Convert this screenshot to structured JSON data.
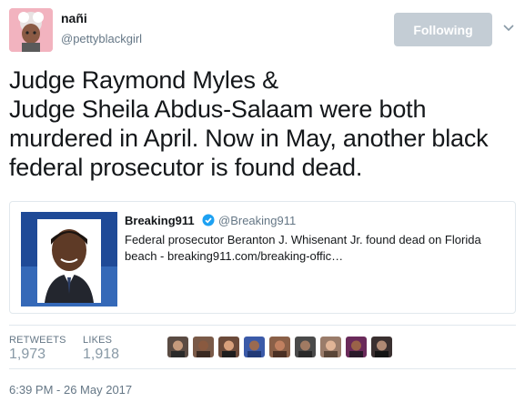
{
  "author": {
    "display_name": "nañi",
    "handle": "@pettyblackgirl"
  },
  "follow_button": {
    "label": "Following"
  },
  "tweet": {
    "lines": [
      "Judge Raymond Myles &",
      "Judge Sheila Abdus-Salaam were both",
      "murdered in April. Now in May, another black",
      "federal prosecutor is found dead."
    ]
  },
  "quoted": {
    "name": "Breaking911",
    "handle": "@Breaking911",
    "text": "Federal prosecutor Beranton J. Whisenant Jr. found dead on Florida beach - breaking911.com/breaking-offic…"
  },
  "stats": {
    "retweets_label": "RETWEETS",
    "retweets_count": "1,973",
    "likes_label": "LIKES",
    "likes_count": "1,918"
  },
  "liker_avatars": [
    {
      "color": "#5a4b43"
    },
    {
      "color": "#7a5a48"
    },
    {
      "color": "#6b4a3a"
    },
    {
      "color": "#3b5aa8"
    },
    {
      "color": "#8a6048"
    },
    {
      "color": "#4a4a4a"
    },
    {
      "color": "#9a7c6a"
    },
    {
      "color": "#6a2a5a"
    },
    {
      "color": "#3a3030"
    }
  ],
  "timestamp": "6:39 PM - 26 May 2017"
}
